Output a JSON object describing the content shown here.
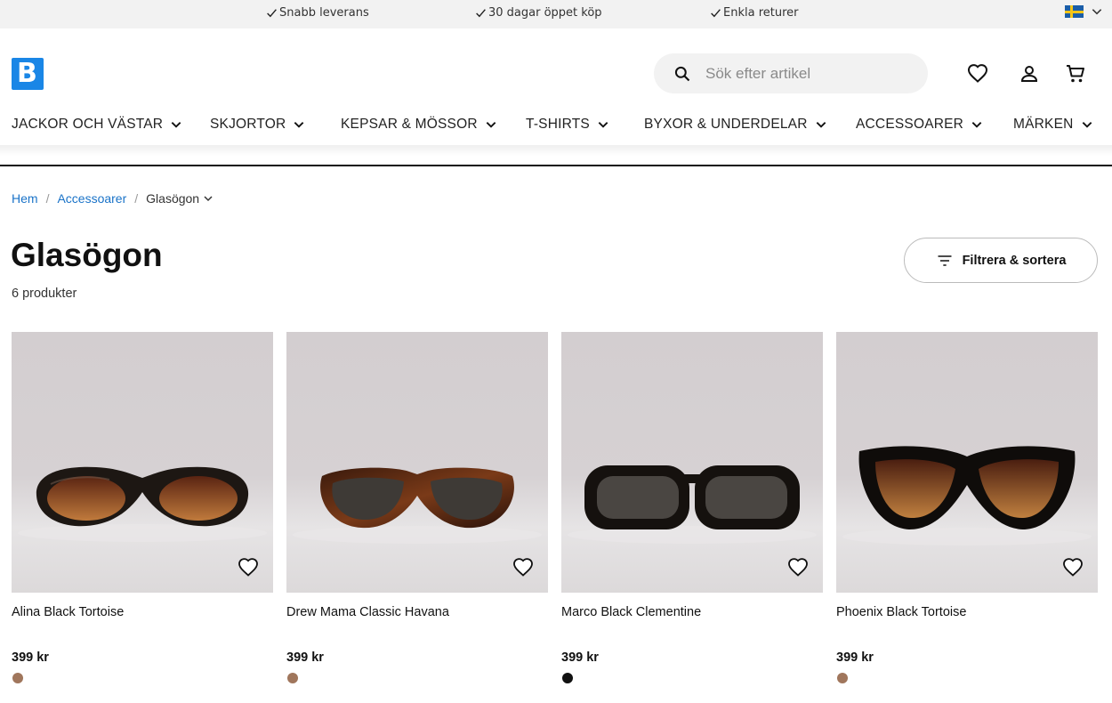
{
  "usp_bar": {
    "items": [
      "Snabb leverans",
      "30 dagar öppet köp",
      "Enkla returer"
    ]
  },
  "header": {
    "logo_letter": "B",
    "search": {
      "placeholder": "Sök efter artikel"
    },
    "icons": [
      "heart-icon",
      "user-icon",
      "cart-icon"
    ]
  },
  "nav": {
    "categories": [
      "JACKOR OCH VÄSTAR",
      "SKJORTOR",
      "KEPSAR & MÖSSOR",
      "T-SHIRTS",
      "BYXOR & UNDERDELAR",
      "ACCESSOARER",
      "MÄRKEN"
    ]
  },
  "breadcrumb": {
    "items": [
      "Hem",
      "Accessoarer"
    ],
    "current": "Glasögon"
  },
  "page": {
    "title": "Glasögon",
    "count": "6 produkter",
    "filter_label": "Filtrera & sortera"
  },
  "products": [
    {
      "name": "Alina Black Tortoise",
      "price": "399 kr",
      "swatch": "#a0765c"
    },
    {
      "name": "Drew Mama Classic Havana",
      "price": "399 kr",
      "swatch": "#a0765c"
    },
    {
      "name": "Marco Black Clementine",
      "price": "399 kr",
      "swatch": "#111111"
    },
    {
      "name": "Phoenix Black Tortoise",
      "price": "399 kr",
      "swatch": "#a0765c"
    }
  ],
  "colors": {
    "accent": "#1a86e6",
    "link": "#1a73c8",
    "usp_bg": "#f2f2f2"
  }
}
